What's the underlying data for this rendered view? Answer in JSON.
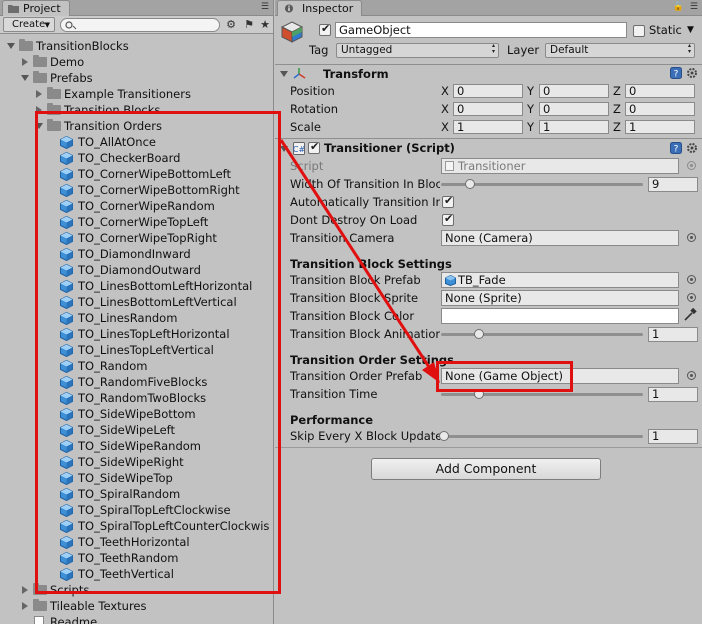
{
  "project": {
    "tab_label": "Project",
    "create_label": "Create",
    "tree": [
      {
        "label": "TransitionBlocks",
        "kind": "folder",
        "depth": 0,
        "state": "open"
      },
      {
        "label": "Demo",
        "kind": "folder",
        "depth": 1,
        "state": "closed"
      },
      {
        "label": "Prefabs",
        "kind": "folder",
        "depth": 1,
        "state": "open"
      },
      {
        "label": "Example Transitioners",
        "kind": "folder",
        "depth": 2,
        "state": "closed"
      },
      {
        "label": "Transition Blocks",
        "kind": "folder",
        "depth": 2,
        "state": "closed"
      },
      {
        "label": "Transition Orders",
        "kind": "folder",
        "depth": 2,
        "state": "open"
      },
      {
        "label": "TO_AllAtOnce",
        "kind": "prefab",
        "depth": 3
      },
      {
        "label": "TO_CheckerBoard",
        "kind": "prefab",
        "depth": 3
      },
      {
        "label": "TO_CornerWipeBottomLeft",
        "kind": "prefab",
        "depth": 3
      },
      {
        "label": "TO_CornerWipeBottomRight",
        "kind": "prefab",
        "depth": 3
      },
      {
        "label": "TO_CornerWipeRandom",
        "kind": "prefab",
        "depth": 3
      },
      {
        "label": "TO_CornerWipeTopLeft",
        "kind": "prefab",
        "depth": 3
      },
      {
        "label": "TO_CornerWipeTopRight",
        "kind": "prefab",
        "depth": 3
      },
      {
        "label": "TO_DiamondInward",
        "kind": "prefab",
        "depth": 3
      },
      {
        "label": "TO_DiamondOutward",
        "kind": "prefab",
        "depth": 3
      },
      {
        "label": "TO_LinesBottomLeftHorizontal",
        "kind": "prefab",
        "depth": 3
      },
      {
        "label": "TO_LinesBottomLeftVertical",
        "kind": "prefab",
        "depth": 3
      },
      {
        "label": "TO_LinesRandom",
        "kind": "prefab",
        "depth": 3
      },
      {
        "label": "TO_LinesTopLeftHorizontal",
        "kind": "prefab",
        "depth": 3
      },
      {
        "label": "TO_LinesTopLeftVertical",
        "kind": "prefab",
        "depth": 3
      },
      {
        "label": "TO_Random",
        "kind": "prefab",
        "depth": 3
      },
      {
        "label": "TO_RandomFiveBlocks",
        "kind": "prefab",
        "depth": 3
      },
      {
        "label": "TO_RandomTwoBlocks",
        "kind": "prefab",
        "depth": 3
      },
      {
        "label": "TO_SideWipeBottom",
        "kind": "prefab",
        "depth": 3
      },
      {
        "label": "TO_SideWipeLeft",
        "kind": "prefab",
        "depth": 3
      },
      {
        "label": "TO_SideWipeRandom",
        "kind": "prefab",
        "depth": 3
      },
      {
        "label": "TO_SideWipeRight",
        "kind": "prefab",
        "depth": 3
      },
      {
        "label": "TO_SideWipeTop",
        "kind": "prefab",
        "depth": 3
      },
      {
        "label": "TO_SpiralRandom",
        "kind": "prefab",
        "depth": 3
      },
      {
        "label": "TO_SpiralTopLeftClockwise",
        "kind": "prefab",
        "depth": 3
      },
      {
        "label": "TO_SpiralTopLeftCounterClockwis",
        "kind": "prefab",
        "depth": 3
      },
      {
        "label": "TO_TeethHorizontal",
        "kind": "prefab",
        "depth": 3
      },
      {
        "label": "TO_TeethRandom",
        "kind": "prefab",
        "depth": 3
      },
      {
        "label": "TO_TeethVertical",
        "kind": "prefab",
        "depth": 3
      },
      {
        "label": "Scripts",
        "kind": "folder",
        "depth": 1,
        "state": "closed"
      },
      {
        "label": "Tileable Textures",
        "kind": "folder",
        "depth": 1,
        "state": "closed"
      },
      {
        "label": "Readme",
        "kind": "doc",
        "depth": 1
      }
    ]
  },
  "inspector": {
    "tab_label": "Inspector",
    "object_name": "GameObject",
    "static_label": "Static",
    "tag_label": "Tag",
    "tag_value": "Untagged",
    "layer_label": "Layer",
    "layer_value": "Default",
    "transform": {
      "title": "Transform",
      "rows": [
        {
          "label": "Position",
          "x": "0",
          "y": "0",
          "z": "0"
        },
        {
          "label": "Rotation",
          "x": "0",
          "y": "0",
          "z": "0"
        },
        {
          "label": "Scale",
          "x": "1",
          "y": "1",
          "z": "1"
        }
      ],
      "axis_x": "X",
      "axis_y": "Y",
      "axis_z": "Z"
    },
    "transitioner": {
      "title": "Transitioner (Script)",
      "script_label": "Script",
      "script_value": "Transitioner",
      "width_label": "Width Of Transition In Bloc",
      "width_value": "9",
      "auto_label": "Automatically Transition Ir",
      "dont_destroy_label": "Dont Destroy On Load",
      "camera_label": "Transition Camera",
      "camera_value": "None (Camera)",
      "block_settings_header": "Transition Block Settings",
      "block_prefab_label": "Transition Block Prefab",
      "block_prefab_value": "TB_Fade",
      "block_sprite_label": "Transition Block Sprite",
      "block_sprite_value": "None (Sprite)",
      "block_color_label": "Transition Block Color",
      "block_anim_label": "Transition Block Animatior",
      "block_anim_value": "1",
      "order_settings_header": "Transition Order Settings",
      "order_prefab_label": "Transition Order Prefab",
      "order_prefab_value": "None (Game Object)",
      "time_label": "Transition Time",
      "time_value": "1",
      "performance_header": "Performance",
      "skip_label": "Skip Every X Block Update",
      "skip_value": "1"
    },
    "add_component_label": "Add Component"
  },
  "colors": {
    "accent_annotation": "#e01010",
    "panel_bg": "#c2c2c2",
    "prefab_icon": "#3d8fd6"
  }
}
